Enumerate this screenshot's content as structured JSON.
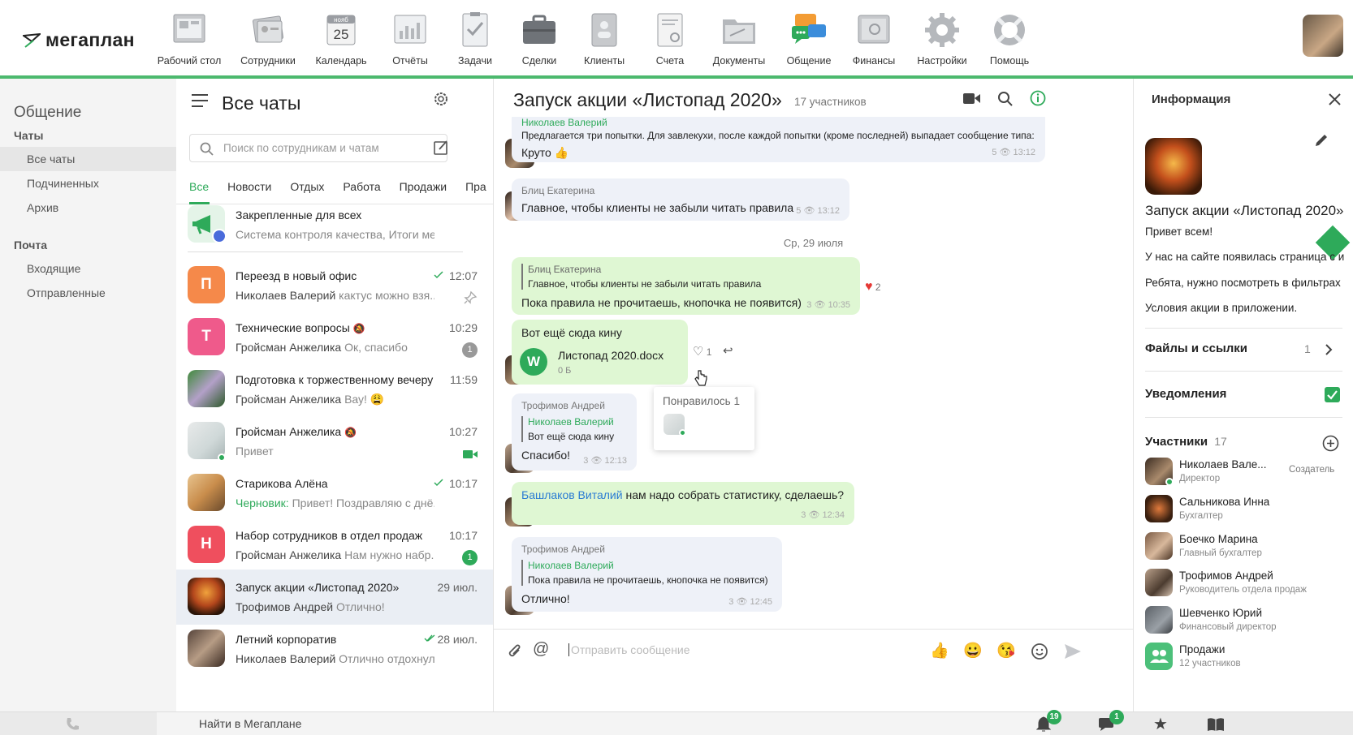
{
  "brand": {
    "logo_text": "мегаплан"
  },
  "nav": {
    "items": [
      {
        "label": "Рабочий стол",
        "icon": "desktop-icon"
      },
      {
        "label": "Сотрудники",
        "icon": "employees-icon"
      },
      {
        "label": "Календарь",
        "icon": "calendar-icon",
        "month": "нояб",
        "day": "25"
      },
      {
        "label": "Отчёты",
        "icon": "reports-icon"
      },
      {
        "label": "Задачи",
        "icon": "tasks-icon"
      },
      {
        "label": "Сделки",
        "icon": "deals-icon"
      },
      {
        "label": "Клиенты",
        "icon": "clients-icon"
      },
      {
        "label": "Счета",
        "icon": "invoices-icon"
      },
      {
        "label": "Документы",
        "icon": "documents-icon"
      },
      {
        "label": "Общение",
        "icon": "chat-bubbles-icon",
        "active": true
      },
      {
        "label": "Финансы",
        "icon": "safe-icon"
      },
      {
        "label": "Настройки",
        "icon": "gear-icon"
      },
      {
        "label": "Помощь",
        "icon": "lifebuoy-icon"
      }
    ]
  },
  "sidebar": {
    "title": "Общение",
    "sections": [
      {
        "label": "Чаты",
        "items": [
          "Все чаты",
          "Подчиненных",
          "Архив"
        ]
      },
      {
        "label": "Почта",
        "items": [
          "Входящие",
          "Отправленные"
        ]
      }
    ]
  },
  "chatlist": {
    "title": "Все чаты",
    "search_placeholder": "Поиск по сотрудникам и чатам",
    "tabs": [
      "Все",
      "Новости",
      "Отдых",
      "Работа",
      "Продажи",
      "Пра"
    ],
    "chats": [
      {
        "name": "Закрепленные для всех",
        "preview_text": "Система контроля качества, Итоги ме...",
        "time": "",
        "badge": ""
      },
      {
        "name": "Переезд в новый офис",
        "author": "Николаев Валерий",
        "preview_text": "кактус можно взя...",
        "time": "12:07",
        "badge": ""
      },
      {
        "name": "Технические вопросы",
        "author": "Гройсман Анжелика",
        "preview_text": "Ок, спасибо",
        "time": "10:29",
        "badge": "1"
      },
      {
        "name": "Подготовка к торжественному вечеру",
        "author": "Гройсман Анжелика",
        "preview_text": "Вау! 😩",
        "time": "11:59",
        "badge": ""
      },
      {
        "name": "Гройсман Анжелика",
        "author": "",
        "preview_text": "Привет",
        "time": "10:27",
        "badge": ""
      },
      {
        "name": "Старикова Алёна",
        "author": "Черновик:",
        "preview_text": "Привет! Поздравляю с днё...",
        "time": "10:17",
        "badge": ""
      },
      {
        "name": "Набор сотрудников в отдел продаж",
        "author": "Гройсман Анжелика",
        "preview_text": "Нам нужно набр...",
        "time": "10:17",
        "badge": "1"
      },
      {
        "name": "Запуск акции «Листопад 2020»",
        "author": "Трофимов Андрей",
        "preview_text": "Отлично!",
        "time": "29 июл.",
        "badge": ""
      },
      {
        "name": "Летний корпоратив",
        "author": "Николаев Валерий",
        "preview_text": "Отлично отдохнули!",
        "time": "28 июл.",
        "badge": ""
      }
    ]
  },
  "main": {
    "title": "Запуск акции «Листопад 2020»",
    "participants": "17 участников",
    "messages": [
      {
        "author": "Николаев Валерий",
        "text_top": "Предлагается три попытки. Для завлекухи, после каждой попытки (кроме последней) выпадает сообщение типа:",
        "text": "Круто 👍",
        "views": "5",
        "time": "13:12"
      },
      {
        "author": "Блиц Екатерина",
        "text": "Главное, чтобы клиенты не забыли читать правила",
        "views": "5",
        "time": "13:12"
      },
      {
        "date": "Ср, 29 июля"
      },
      {
        "quote_author": "Блиц Екатерина",
        "quote_text": "Главное, чтобы клиенты не забыли читать правила",
        "text": "Пока правила не прочитаешь, кнопочка не появится)",
        "views": "3",
        "time": "10:35",
        "likes": "2"
      },
      {
        "text": "Вот ещё сюда кину",
        "file_name": "Листопад 2020.docx",
        "file_size": "0 Б",
        "likes": "1"
      },
      {
        "author": "Трофимов Андрей",
        "quote_author": "Николаев Валерий",
        "quote_text": "Вот ещё сюда кину",
        "text": "Спасибо!",
        "views": "3",
        "time": "12:13"
      },
      {
        "mention": "Башлаков Виталий",
        "text": " нам надо собрать статистику, сделаешь?",
        "views": "3",
        "time": "12:34"
      },
      {
        "author": "Трофимов Андрей",
        "quote_author": "Николаев Валерий",
        "quote_text": "Пока правила не прочитаешь, кнопочка не появится)",
        "text": "Отлично!",
        "views": "3",
        "time": "12:45"
      }
    ],
    "tooltip": "Понравилось 1",
    "composer_placeholder": "Отправить сообщение"
  },
  "info": {
    "title": "Информация",
    "chat_name": "Запуск акции «Листопад 2020»",
    "lines": [
      "Привет всем!",
      "У нас на сайте появилась страница с и",
      "Ребята, нужно посмотреть в фильтрах",
      "Условия акции в приложении."
    ],
    "files_label": "Файлы и ссылки",
    "files_count": "1",
    "notifications_label": "Уведомления",
    "members_label": "Участники",
    "members_count": "17",
    "members": [
      {
        "name": "Николаев Вале...",
        "role": "Директор",
        "tag": "Создатель"
      },
      {
        "name": "Сальникова Инна",
        "role": "Бухгалтер"
      },
      {
        "name": "Боечко Марина",
        "role": "Главный бухгалтер"
      },
      {
        "name": "Трофимов Андрей",
        "role": "Руководитель отдела продаж"
      },
      {
        "name": "Шевченко Юрий",
        "role": "Финансовый директор"
      },
      {
        "name": "Продажи",
        "role": "12 участников"
      }
    ]
  },
  "bottombar": {
    "search": "Найти в Мегаплане",
    "notif_count": "19",
    "msg_count": "1"
  },
  "colors": {
    "accent": "#4cb96e",
    "selected": "#eaeef4",
    "out_bubble": "#dff7d3",
    "in_bubble": "#eef1f8"
  }
}
